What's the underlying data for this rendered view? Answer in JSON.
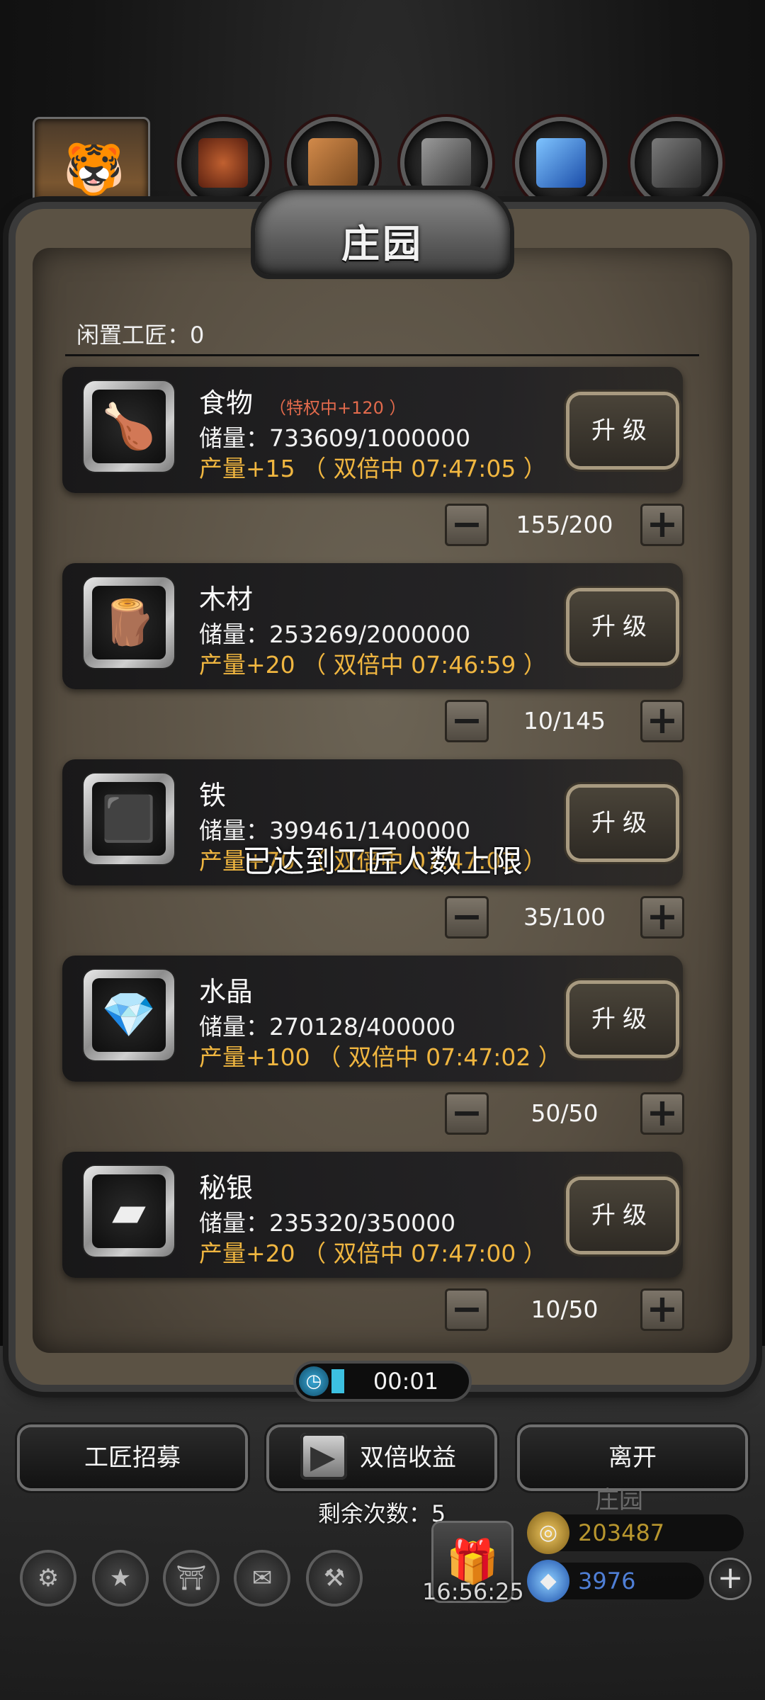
{
  "panel": {
    "title": "庄园",
    "idle_craftsmen": "闲置工匠：0"
  },
  "resources": [
    {
      "icon": "food-icon",
      "name": "食物",
      "privilege": "（特权中+120 ）",
      "storage": "储量：733609/1000000",
      "output": "产量+15 （ 双倍中 07:47:05 ）",
      "upgrade": "升级",
      "workers": "155/200"
    },
    {
      "icon": "wood-icon",
      "name": "木材",
      "privilege": "",
      "storage": "储量：253269/2000000",
      "output": "产量+20 （ 双倍中 07:46:59 ）",
      "upgrade": "升级",
      "workers": "10/145"
    },
    {
      "icon": "iron-icon",
      "name": "铁",
      "privilege": "",
      "storage": "储量：399461/1400000",
      "output": "产量+70 （ 双倍中 07:47:03 ）",
      "upgrade": "升级",
      "workers": "35/100"
    },
    {
      "icon": "crystal-icon",
      "name": "水晶",
      "privilege": "",
      "storage": "储量：270128/400000",
      "output": "产量+100 （ 双倍中 07:47:02 ）",
      "upgrade": "升级",
      "workers": "50/50"
    },
    {
      "icon": "mithril-icon",
      "name": "秘银",
      "privilege": "",
      "storage": "储量：235320/350000",
      "output": "产量+20 （ 双倍中 07:47:00 ）",
      "upgrade": "升级",
      "workers": "10/50"
    }
  ],
  "stepper": {
    "minus": "−",
    "plus": "+"
  },
  "toast": "已达到工匠人数上限",
  "timer": "00:01",
  "buttons": {
    "recruit": "工匠招募",
    "double": "双倍收益",
    "leave": "离开"
  },
  "remaining": "剩余次数：5",
  "hud": {
    "clock": "16:56:25",
    "gold": "203487",
    "gems": "3976",
    "manor_label": "庄园"
  },
  "colors": {
    "output": "#f0b640",
    "privilege": "#e26a4c",
    "gold": "#b8962e",
    "gems": "#4f7fd6"
  }
}
